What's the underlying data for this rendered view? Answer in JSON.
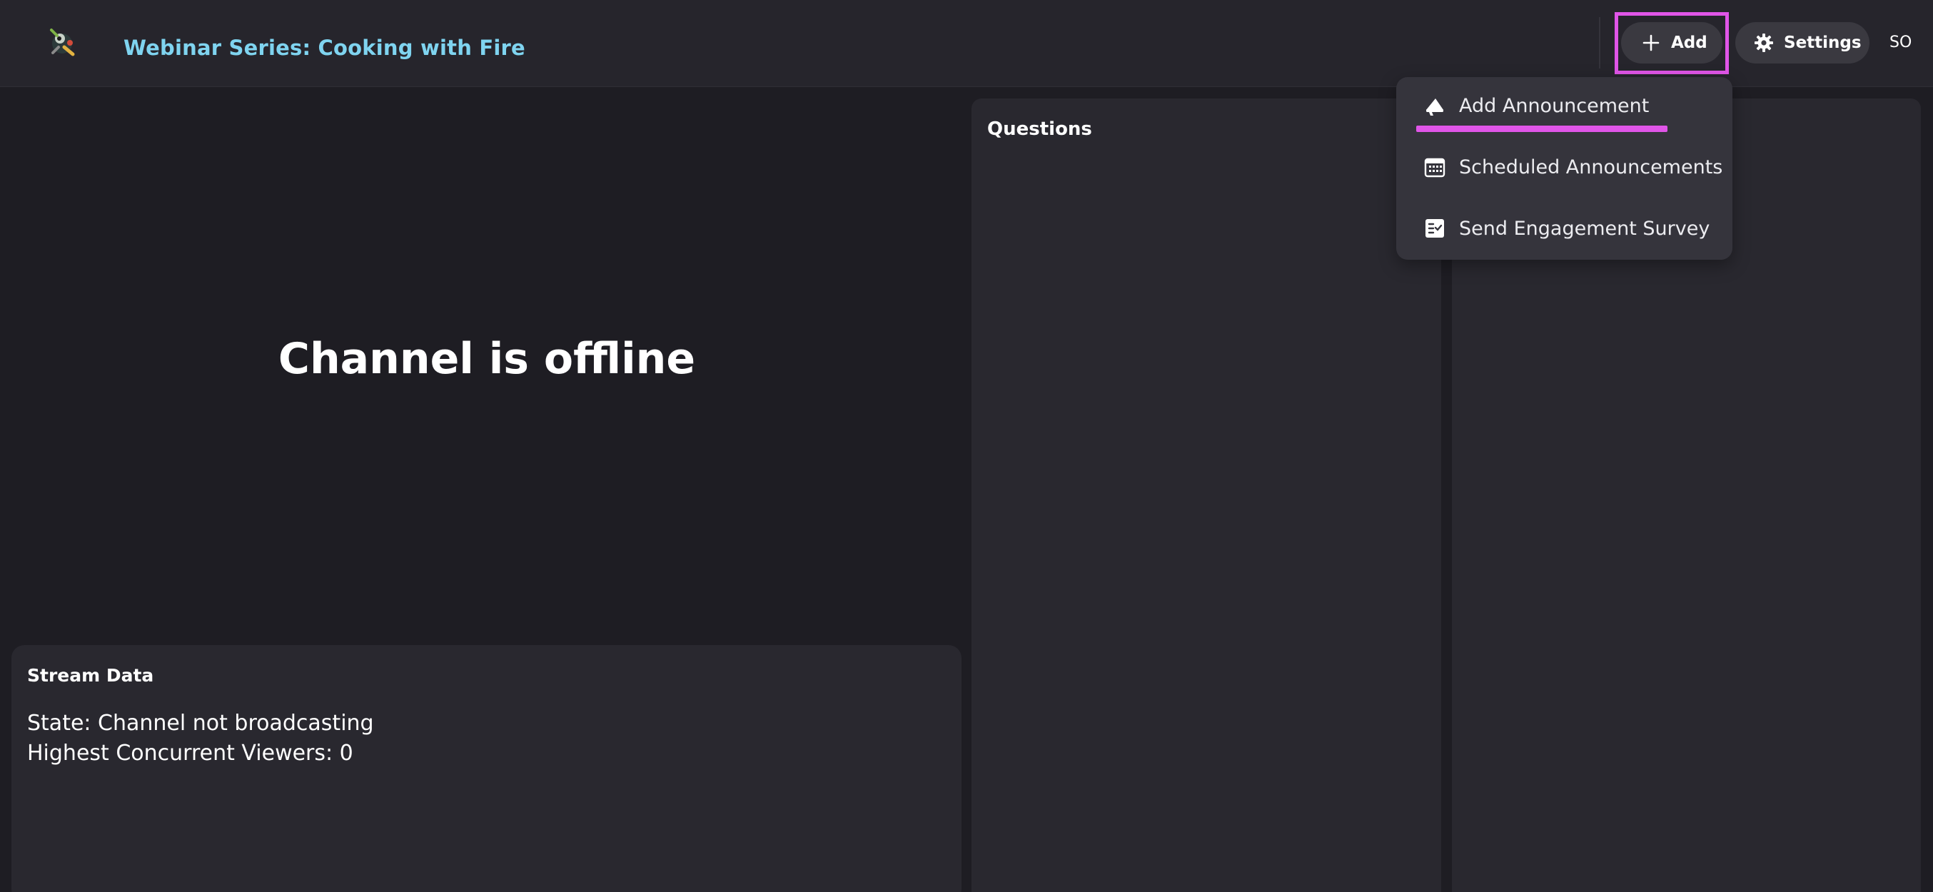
{
  "header": {
    "title": "Webinar Series: Cooking with Fire",
    "add_label": "Add",
    "settings_label": "Settings",
    "user_initials": "SO"
  },
  "video": {
    "status_text": "Channel is offline"
  },
  "stream_data": {
    "title": "Stream Data",
    "state": "State: Channel not broadcasting",
    "viewers": "Highest Concurrent Viewers: 0"
  },
  "questions": {
    "title": "Questions"
  },
  "add_menu": {
    "items": [
      {
        "label": "Add Announcement",
        "icon": "megaphone-icon"
      },
      {
        "label": "Scheduled Announcements",
        "icon": "calendar-icon"
      },
      {
        "label": "Send Engagement Survey",
        "icon": "survey-checklist-icon"
      }
    ]
  },
  "colors": {
    "accent_highlight": "#e055e8",
    "title_color": "#7fd4f0",
    "background": "#1e1d23",
    "panel": "#29282f"
  }
}
